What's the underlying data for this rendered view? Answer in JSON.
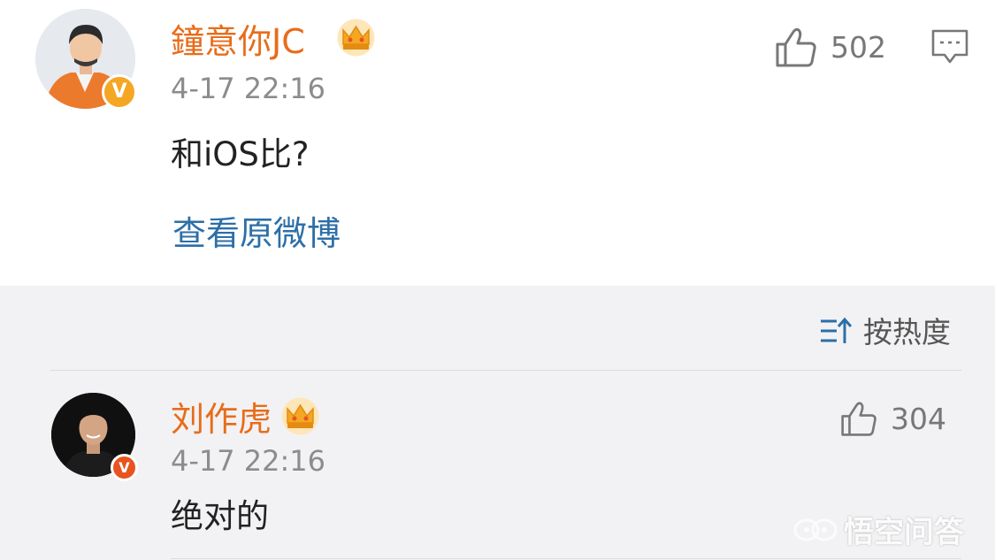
{
  "comments": [
    {
      "name": "鐘意你JC",
      "time": "4-17 22:16",
      "text": "和iOS比?",
      "likes": "502",
      "avatar_icon": "user-avatar",
      "badge_color": "#f5a623",
      "badge_text": "V",
      "vip_icon": "crown-icon",
      "link": "查看原微博"
    },
    {
      "name": "刘作虎",
      "time": "4-17 22:16",
      "text": "绝对的",
      "likes": "304",
      "avatar_icon": "user-avatar",
      "badge_color": "#e8541e",
      "badge_text": "V",
      "vip_icon": "crown-icon"
    }
  ],
  "sort": {
    "label": "按热度",
    "icon": "sort-icon"
  },
  "watermark": {
    "text": "悟空问答"
  },
  "colors": {
    "username": "#e86c1a",
    "link": "#2d6fa7",
    "timestamp": "#8c8c8c",
    "panel_background": "#f2f2f4"
  }
}
